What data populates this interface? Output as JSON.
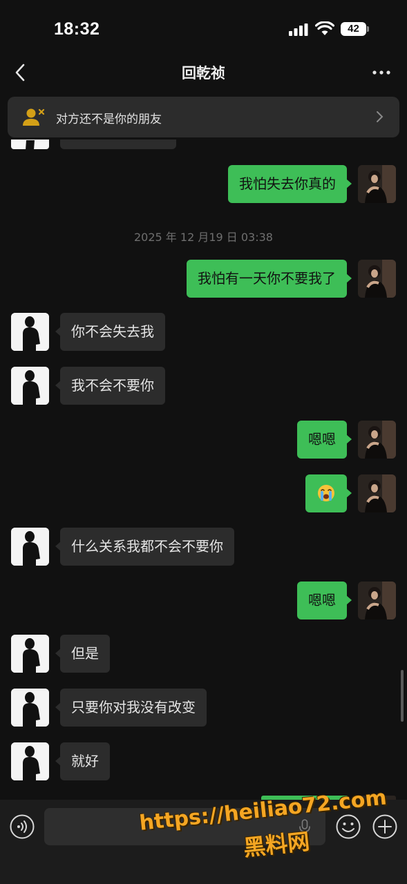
{
  "status_bar": {
    "time": "18:32",
    "battery": "42",
    "icons": [
      "signal-icon",
      "wifi-icon",
      "battery-icon"
    ]
  },
  "nav": {
    "title": "回乾祯",
    "back_icon": "chevron-left-icon",
    "more_icon": "more-dots-icon"
  },
  "banner": {
    "text": "对方还不是你的朋友",
    "icon": "add-friend-icon",
    "accent_color": "#d4a017"
  },
  "chat": {
    "timestamp": "2025 年 12 月19 日 03:38",
    "messages": [
      {
        "side": "right",
        "text": "我怕失去你真的"
      },
      {
        "side": "right",
        "text": "我怕有一天你不要我了"
      },
      {
        "side": "left",
        "text": "你不会失去我"
      },
      {
        "side": "left",
        "text": "我不会不要你"
      },
      {
        "side": "right",
        "text": "嗯嗯"
      },
      {
        "side": "right",
        "emoji": "loudly-crying-face-emoji"
      },
      {
        "side": "left",
        "text": "什么关系我都不会不要你"
      },
      {
        "side": "right",
        "text": "嗯嗯"
      },
      {
        "side": "left",
        "text": "但是"
      },
      {
        "side": "left",
        "text": "只要你对我没有改变"
      },
      {
        "side": "left",
        "text": "就好"
      }
    ]
  },
  "input_bar": {
    "placeholder": "",
    "voice_icon": "voice-icon",
    "emoji_icon": "smiley-icon",
    "plus_icon": "plus-icon"
  },
  "watermark": {
    "url": "https://heiliao72.com",
    "name": "黑料网"
  },
  "colors": {
    "background": "#111111",
    "bubble_self": "#3ebe57",
    "bubble_other": "#2c2c2c",
    "watermark": "#f5a623"
  }
}
